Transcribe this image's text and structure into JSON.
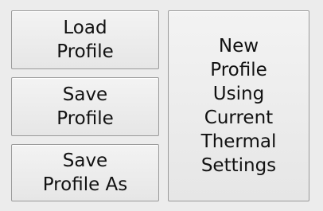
{
  "buttons": {
    "load_profile": "Load\nProfile",
    "save_profile": "Save\nProfile",
    "save_profile_as": "Save\nProfile As",
    "new_profile": "New\nProfile\nUsing\nCurrent\nThermal\nSettings"
  }
}
